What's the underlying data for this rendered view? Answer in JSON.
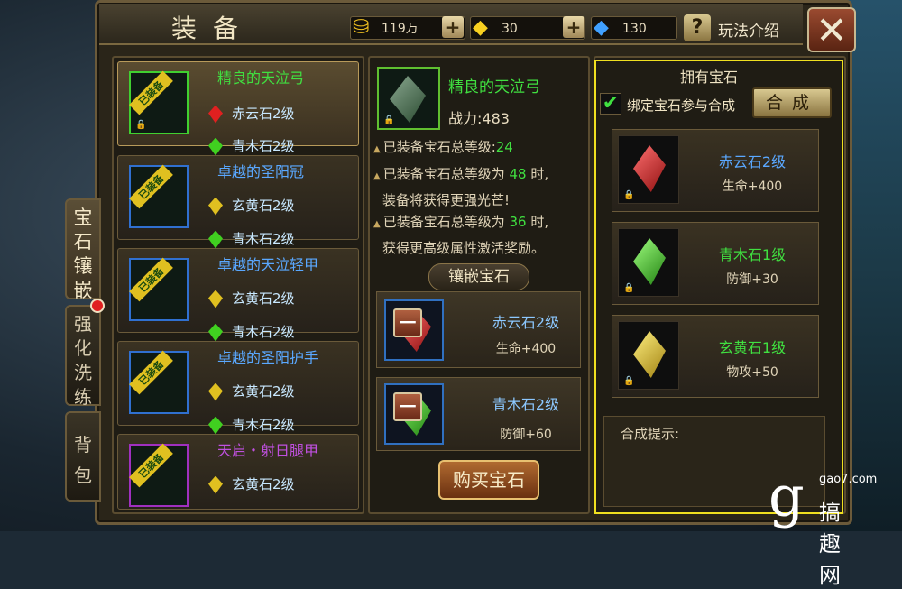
{
  "header": {
    "title": "装备",
    "gold": "119万",
    "gold_icon": "gold-coins-icon",
    "yellow_gem_count": "30",
    "blue_diamond_count": "130",
    "help_label": "玩法介绍",
    "help_icon": "?"
  },
  "side_tabs": [
    {
      "label": "宝石镶嵌",
      "active": true
    },
    {
      "label": "强化洗练",
      "active": false,
      "notify": true
    },
    {
      "label": "背包",
      "active": false
    }
  ],
  "equipment": [
    {
      "name": "精良的天泣弓",
      "name_color": "#40e040",
      "frame": "#40d030",
      "badge": "已装备",
      "gems": [
        {
          "name": "赤云石2级",
          "color": "#e02020"
        },
        {
          "name": "青木石2级",
          "color": "#40d020"
        }
      ]
    },
    {
      "name": "卓越的圣阳冠",
      "name_color": "#5aa8ff",
      "frame": "#3070d0",
      "badge": "已装备",
      "gems": [
        {
          "name": "玄黄石2级",
          "color": "#e0c020"
        },
        {
          "name": "青木石2级",
          "color": "#40d020"
        }
      ]
    },
    {
      "name": "卓越的天泣轻甲",
      "name_color": "#5aa8ff",
      "frame": "#3070d0",
      "badge": "已装备",
      "gems": [
        {
          "name": "玄黄石2级",
          "color": "#e0c020"
        },
        {
          "name": "青木石2级",
          "color": "#40d020"
        }
      ]
    },
    {
      "name": "卓越的圣阳护手",
      "name_color": "#5aa8ff",
      "frame": "#3070d0",
      "badge": "已装备",
      "gems": [
        {
          "name": "玄黄石2级",
          "color": "#e0c020"
        },
        {
          "name": "青木石2级",
          "color": "#40d020"
        }
      ]
    },
    {
      "name": "天启・射日腿甲",
      "name_color": "#c050e0",
      "frame": "#a030c0",
      "badge": "已装备",
      "gems": [
        {
          "name": "玄黄石2级",
          "color": "#e0c020"
        }
      ]
    }
  ],
  "selected": {
    "name": "精良的天泣弓",
    "power_label": "战力:",
    "power_value": "483",
    "total_level_label": "已装备宝石总等级:",
    "total_level": "24",
    "line2_pre": "已装备宝石总等级为",
    "line2_num": "48",
    "line2_post": "时,",
    "line2_b": "装备将获得更强光芒!",
    "line3_pre": "已装备宝石总等级为",
    "line3_num": "36",
    "line3_post": "时,",
    "line3_b": "获得更高级属性激活奖励。"
  },
  "inlay": {
    "heading": "镶嵌宝石",
    "slots": [
      {
        "name": "赤云石2级",
        "stat": "生命+400",
        "color": "#e02020"
      },
      {
        "name": "青木石2级",
        "stat": "防御+60",
        "color": "#40d020"
      }
    ],
    "buy_label": "购买宝石"
  },
  "owned": {
    "title": "拥有宝石",
    "bind_label": "绑定宝石参与合成",
    "bind_checked": true,
    "combine_label": "合成",
    "gems": [
      {
        "name": "赤云石2级",
        "stat": "生命+400",
        "color": "#e02020",
        "name_color": "#5aa8ff"
      },
      {
        "name": "青木石1级",
        "stat": "防御+30",
        "color": "#40d020",
        "name_color": "#40e040"
      },
      {
        "name": "玄黄石1级",
        "stat": "物攻+50",
        "color": "#e0c020",
        "name_color": "#40e040"
      }
    ],
    "hint_label": "合成提示:"
  },
  "watermark": {
    "logo": "g",
    "site": "gao7.com",
    "name": "搞趣网"
  }
}
